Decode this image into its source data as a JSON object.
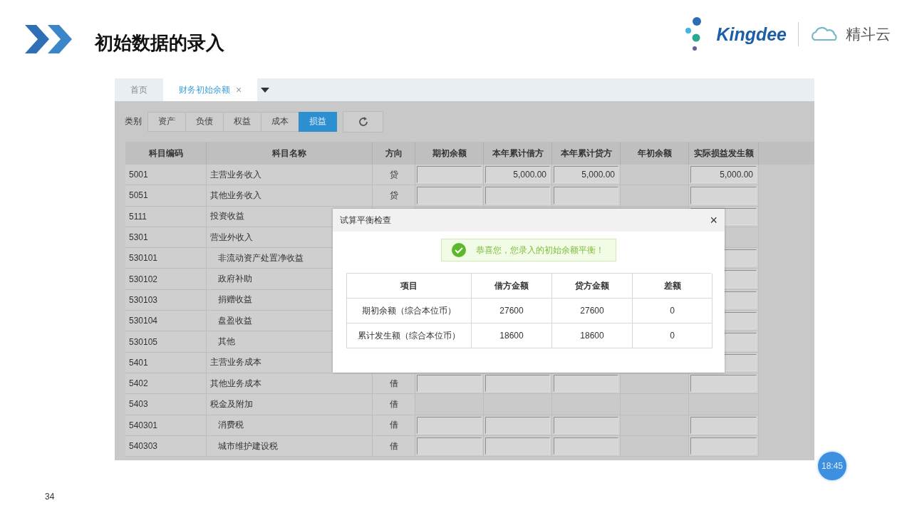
{
  "slide": {
    "title": "初始数据的录入",
    "page_number": "34"
  },
  "logo": {
    "brand": "Kingdee",
    "product": "精斗云"
  },
  "tabs": [
    {
      "label": "首页",
      "selected": false
    },
    {
      "label": "财务初始余额",
      "selected": true,
      "close": "×"
    }
  ],
  "category": {
    "label": "类别",
    "buttons": [
      {
        "label": "资产",
        "selected": false
      },
      {
        "label": "负债",
        "selected": false
      },
      {
        "label": "权益",
        "selected": false
      },
      {
        "label": "成本",
        "selected": false
      },
      {
        "label": "损益",
        "selected": true
      }
    ]
  },
  "table": {
    "columns": [
      "科目编码",
      "科目名称",
      "方向",
      "期初余额",
      "本年累计借方",
      "本年累计贷方",
      "年初余额",
      "实际损益发生额"
    ],
    "rows": [
      {
        "code": "5001",
        "name": "主营业务收入",
        "direction": "贷",
        "debit": "5,000.00",
        "credit": "5,000.00",
        "actual": "5,000.00"
      },
      {
        "code": "5051",
        "name": "其他业务收入",
        "direction": "贷"
      },
      {
        "code": "5111",
        "name": "投资收益"
      },
      {
        "code": "5301",
        "name": "营业外收入",
        "children": [
          {
            "code": "530101",
            "name": "非流动资产处置净收益"
          },
          {
            "code": "530102",
            "name": "政府补助"
          },
          {
            "code": "530103",
            "name": "捐赠收益"
          },
          {
            "code": "530104",
            "name": "盘盈收益"
          },
          {
            "code": "530105",
            "name": "其他"
          }
        ]
      },
      {
        "code": "5401",
        "name": "主营业务成本"
      },
      {
        "code": "5402",
        "name": "其他业务成本",
        "direction": "借"
      },
      {
        "code": "5403",
        "name": "税金及附加",
        "direction": "借",
        "children": [
          {
            "code": "540301",
            "name": "消费税",
            "direction": "借"
          },
          {
            "code": "540303",
            "name": "城市维护建设税",
            "direction": "借"
          }
        ]
      }
    ]
  },
  "dialog": {
    "title": "试算平衡检查",
    "close": "×",
    "message": "恭喜您，您录入的初始余额平衡！",
    "columns": [
      "项目",
      "借方金额",
      "贷方金额",
      "差额"
    ],
    "rows": [
      [
        "期初余额（综合本位币）",
        "27600",
        "27600",
        "0"
      ],
      [
        "累计发生额（综合本位币）",
        "18600",
        "18600",
        "0"
      ]
    ]
  },
  "clock": "18:45"
}
